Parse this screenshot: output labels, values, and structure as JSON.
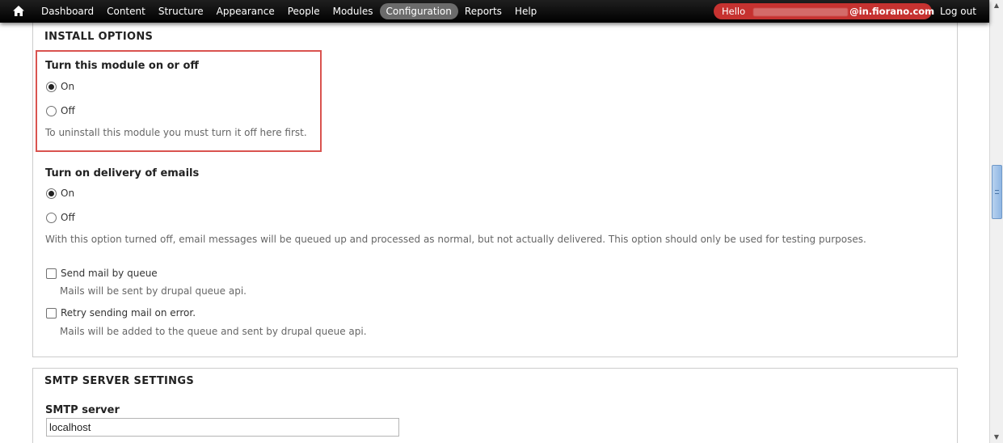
{
  "toolbar": {
    "home_icon": "home-icon",
    "nav": [
      {
        "label": "Dashboard"
      },
      {
        "label": "Content"
      },
      {
        "label": "Structure"
      },
      {
        "label": "Appearance"
      },
      {
        "label": "People"
      },
      {
        "label": "Modules"
      },
      {
        "label": "Configuration",
        "active": true
      },
      {
        "label": "Reports"
      },
      {
        "label": "Help"
      }
    ],
    "user": {
      "hello": "Hello",
      "domain": "@in.fiorano.com"
    },
    "logout_label": "Log out"
  },
  "install_options": {
    "legend": "INSTALL OPTIONS",
    "module_toggle": {
      "title": "Turn this module on or off",
      "options": [
        {
          "label": "On",
          "checked": true
        },
        {
          "label": "Off",
          "checked": false
        }
      ],
      "description": "To uninstall this module you must turn it off here first."
    },
    "email_delivery": {
      "title": "Turn on delivery of emails",
      "options": [
        {
          "label": "On",
          "checked": true
        },
        {
          "label": "Off",
          "checked": false
        }
      ],
      "description": "With this option turned off, email messages will be queued up and processed as normal, but not actually delivered. This option should only be used for testing purposes."
    },
    "send_by_queue": {
      "label": "Send mail by queue",
      "checked": false,
      "description": "Mails will be sent by drupal queue api."
    },
    "retry_on_error": {
      "label": "Retry sending mail on error.",
      "checked": false,
      "description": "Mails will be added to the queue and sent by drupal queue api."
    }
  },
  "smtp_settings": {
    "legend": "SMTP SERVER SETTINGS",
    "server": {
      "title": "SMTP server",
      "value": "localhost"
    }
  },
  "colors": {
    "toolbar_bg": "#000000",
    "active_tab": "#6b6b6b",
    "user_pill": "#c63230",
    "highlight": "#d9534f"
  }
}
